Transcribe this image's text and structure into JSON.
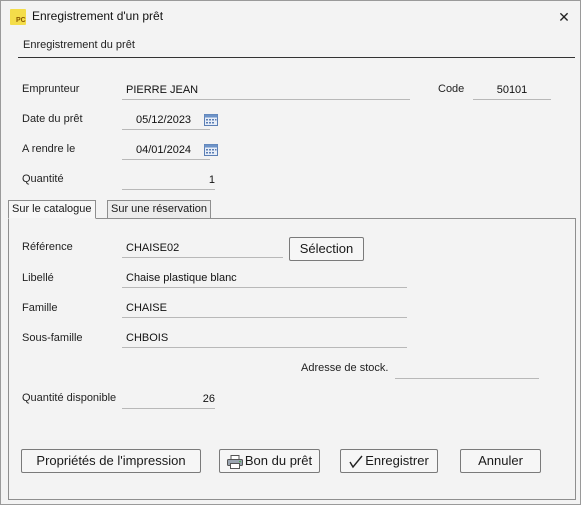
{
  "window": {
    "title": "Enregistrement d'un prêt",
    "app_icon_text": "PC",
    "close_glyph": "✕"
  },
  "section": {
    "title": "Enregistrement du prêt"
  },
  "form": {
    "borrower_label": "Emprunteur",
    "borrower_value": "PIERRE JEAN",
    "code_label": "Code",
    "code_value": "50101",
    "loan_date_label": "Date du prêt",
    "loan_date_value": "05/12/2023",
    "return_label": "A rendre le",
    "return_value": "04/01/2024",
    "quantity_label": "Quantité",
    "quantity_value": "1"
  },
  "tabs": [
    {
      "label": "Sur le catalogue",
      "active": true
    },
    {
      "label": "Sur une réservation",
      "active": false
    }
  ],
  "catalogue": {
    "reference_label": "Référence",
    "reference_value": "CHAISE02",
    "selection_button": "Sélection",
    "libelle_label": "Libellé",
    "libelle_value": "Chaise plastique blanc",
    "famille_label": "Famille",
    "famille_value": "CHAISE",
    "sousfamille_label": "Sous-famille",
    "sousfamille_value": "CHBOIS",
    "stock_address_label": "Adresse de stock.",
    "stock_address_value": "",
    "qty_available_label": "Quantité disponible",
    "qty_available_value": "26"
  },
  "buttons": {
    "print_properties": "Propriétés de l'impression",
    "loan_voucher": "Bon du prêt",
    "save": "Enregistrer",
    "cancel": "Annuler"
  },
  "icons": {
    "calendar": "calendar-icon",
    "printer": "printer-icon",
    "check": "checkmark-icon"
  }
}
